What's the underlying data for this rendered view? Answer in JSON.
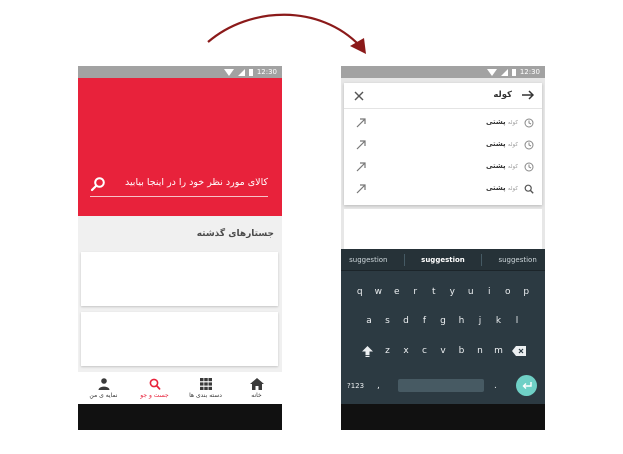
{
  "status_bar": {
    "time": "12:30"
  },
  "left_screen": {
    "search": {
      "placeholder": "کالای مورد نظر خود را در اینجا بیابید"
    },
    "history": {
      "title": "جستارهای گذشته"
    },
    "bottom_nav": [
      {
        "label": "خانه",
        "icon": "home-icon",
        "active": false
      },
      {
        "label": "دسته بندی ها",
        "icon": "grid-icon",
        "active": false
      },
      {
        "label": "جست و جو",
        "icon": "search-icon",
        "active": true
      },
      {
        "label": "نمایه ی من",
        "icon": "person-icon",
        "active": false
      }
    ],
    "accent_color": "#e8223b"
  },
  "right_screen": {
    "query": "کوله",
    "suggestions": [
      {
        "prefix": "کوله",
        "completion": "پشتی",
        "icon": "history-icon"
      },
      {
        "prefix": "کوله",
        "completion": "پشتی",
        "icon": "history-icon"
      },
      {
        "prefix": "کوله",
        "completion": "پشتی",
        "icon": "history-icon"
      },
      {
        "prefix": "کوله",
        "completion": "پشتی",
        "icon": "search-icon"
      }
    ],
    "keyboard": {
      "suggestions": [
        "suggestion",
        "suggestion",
        "suggestion"
      ],
      "row1": [
        "q",
        "w",
        "e",
        "r",
        "t",
        "y",
        "u",
        "i",
        "o",
        "p"
      ],
      "row2": [
        "a",
        "s",
        "d",
        "f",
        "g",
        "h",
        "j",
        "k",
        "l"
      ],
      "row3": [
        "z",
        "x",
        "c",
        "v",
        "b",
        "n",
        "m"
      ],
      "num_key": "?123",
      "comma_key": ",",
      "period_key": "."
    }
  }
}
